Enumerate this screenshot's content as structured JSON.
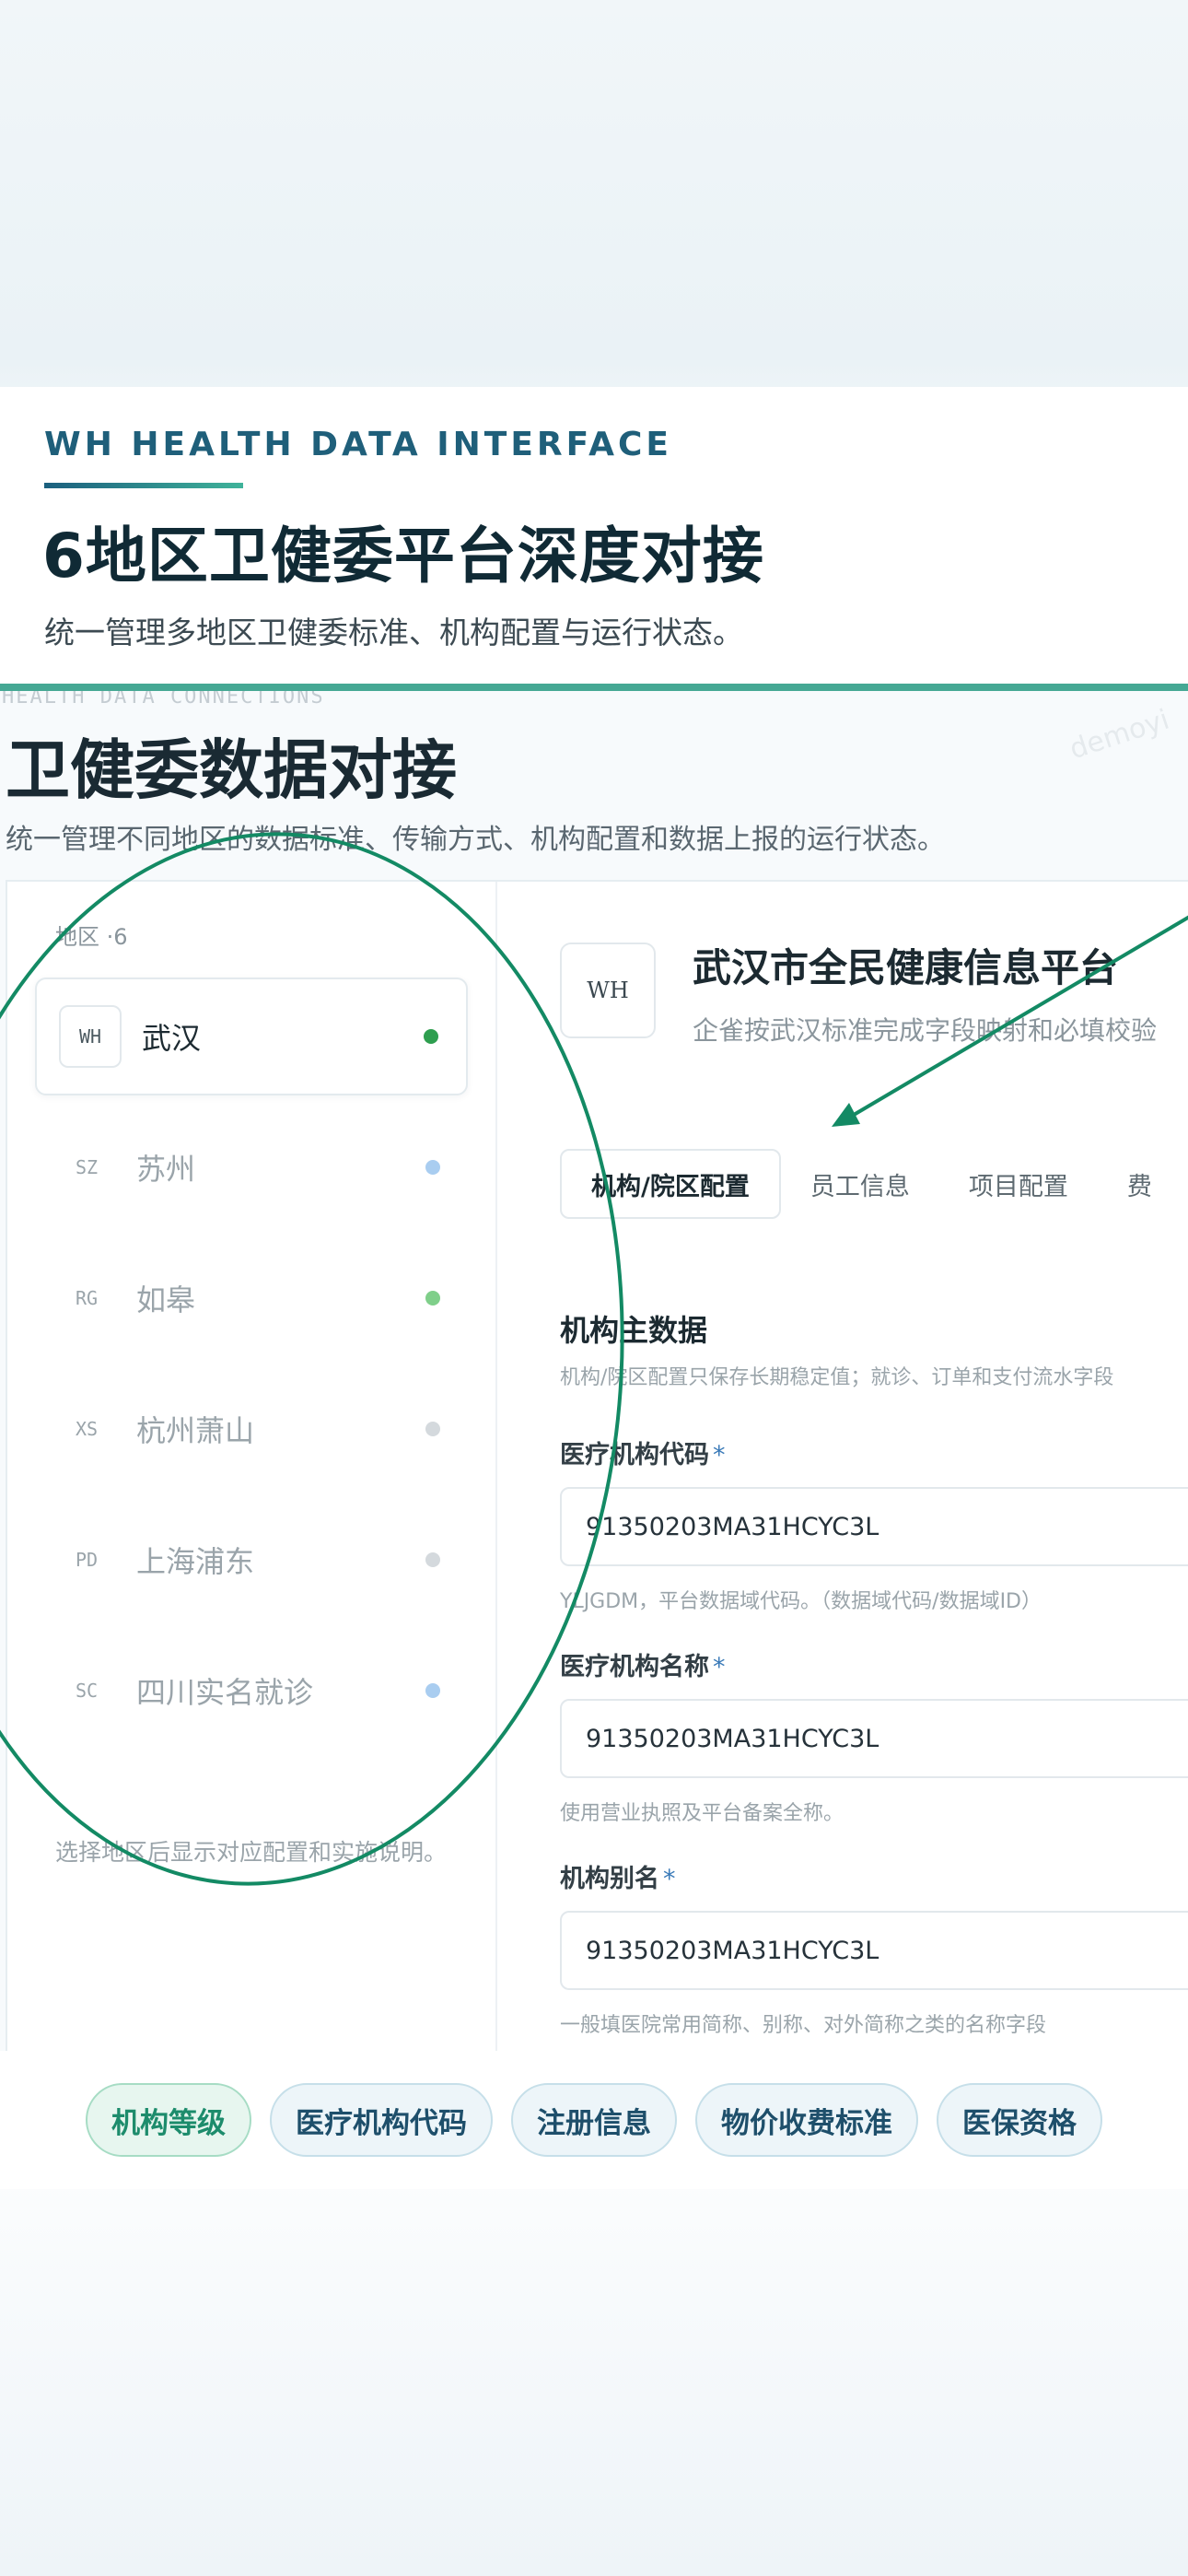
{
  "hero": {
    "eyebrow": "WH HEALTH DATA INTERFACE",
    "title": "6地区卫健委平台深度对接",
    "subtitle": "统一管理多地区卫健委标准、机构配置与运行状态。"
  },
  "screenshot": {
    "faint_header": "HEALTH DATA CONNECTIONS",
    "title": "卫健委数据对接",
    "subtitle": "统一管理不同地区的数据标准、传输方式、机构配置和数据上报的运行状态。",
    "watermark": "demoyi",
    "regions": {
      "header": "地区 ·6",
      "items": [
        {
          "code": "WH",
          "name": "武汉",
          "dot": "#2e9e4f",
          "active": true
        },
        {
          "code": "SZ",
          "name": "苏州",
          "dot": "#a9cdf0",
          "active": false
        },
        {
          "code": "RG",
          "name": "如皋",
          "dot": "#7fcf8a",
          "active": false
        },
        {
          "code": "XS",
          "name": "杭州萧山",
          "dot": "#d4d9dd",
          "active": false
        },
        {
          "code": "PD",
          "name": "上海浦东",
          "dot": "#d4d9dd",
          "active": false
        },
        {
          "code": "SC",
          "name": "四川实名就诊",
          "dot": "#a9cdf0",
          "active": false
        }
      ],
      "footer": "选择地区后显示对应配置和实施说明。"
    },
    "detail": {
      "badge": "WH",
      "title": "武汉市全民健康信息平台",
      "subtitle": "企雀按武汉标准完成字段映射和必填校验",
      "tabs": [
        "机构/院区配置",
        "员工信息",
        "项目配置",
        "费"
      ],
      "section_title": "机构主数据",
      "section_note": "机构/院区配置只保存长期稳定值；就诊、订单和支付流水字段",
      "fields": [
        {
          "label": "医疗机构代码",
          "required": "*",
          "value": "91350203MA31HCYC3L",
          "hint": "YLJGDM，平台数据域代码。（数据域代码/数据域ID）"
        },
        {
          "label": "医疗机构名称",
          "required": "*",
          "value": "91350203MA31HCYC3L",
          "hint": "使用营业执照及平台备案全称。"
        },
        {
          "label": "机构别名",
          "required": "*",
          "value": "91350203MA31HCYC3L",
          "hint": "一般填医院常用简称、别称、对外简称之类的名称字段"
        }
      ]
    }
  },
  "chips": [
    "机构等级",
    "医疗机构代码",
    "注册信息",
    "物价收费标准",
    "医保资格"
  ],
  "colors": {
    "accent_green": "#1d8c6c",
    "brand_blue": "#1f5f7a",
    "annotation": "#138a64"
  }
}
